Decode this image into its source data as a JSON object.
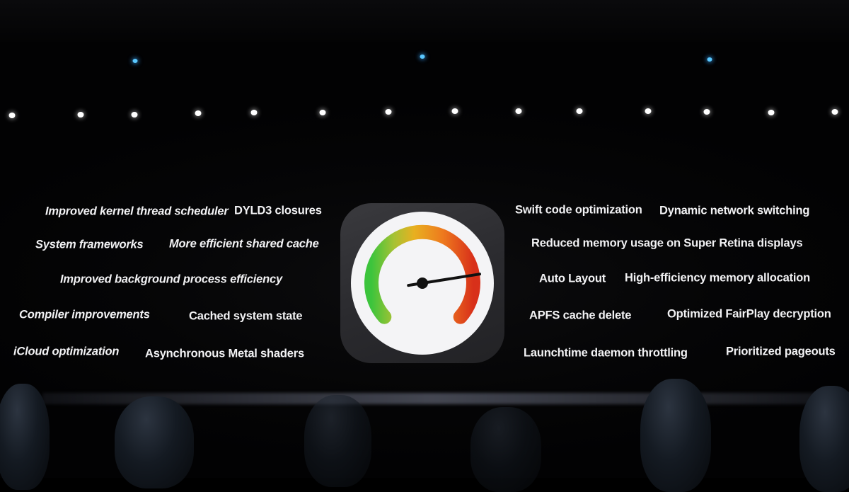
{
  "scene": {
    "description": "Keynote stage slide listing performance improvements around a speedometer icon",
    "colors": {
      "background": "#000000",
      "text": "#f2f2f4",
      "tile": "#2e2e32",
      "dial_face": "#f4f4f6",
      "gauge_green": "#3cc43c",
      "gauge_yellow": "#e8b020",
      "gauge_orange": "#ee7a1e",
      "gauge_red": "#d8301a",
      "needle": "#111111",
      "stage_light": "#ffffff",
      "accent_light": "#5ac8ff"
    }
  },
  "left_items": [
    {
      "label": "Improved kernel thread scheduler"
    },
    {
      "label": "DYLD3 closures"
    },
    {
      "label": "System frameworks"
    },
    {
      "label": "More efficient shared cache"
    },
    {
      "label": "Improved background process efficiency"
    },
    {
      "label": "Compiler improvements"
    },
    {
      "label": "Cached system state"
    },
    {
      "label": "iCloud optimization"
    },
    {
      "label": "Asynchronous Metal shaders"
    }
  ],
  "right_items": [
    {
      "label": "Swift code optimization"
    },
    {
      "label": "Dynamic network switching"
    },
    {
      "label": "Reduced memory usage on Super Retina displays"
    },
    {
      "label": "Auto Layout"
    },
    {
      "label": "High-efficiency memory allocation"
    },
    {
      "label": "APFS cache delete"
    },
    {
      "label": "Optimized FairPlay decryption"
    },
    {
      "label": "Launchtime daemon throttling"
    },
    {
      "label": "Prioritized pageouts"
    }
  ],
  "center_icon": {
    "name": "speedometer",
    "needle_reading_fraction": 0.8
  }
}
